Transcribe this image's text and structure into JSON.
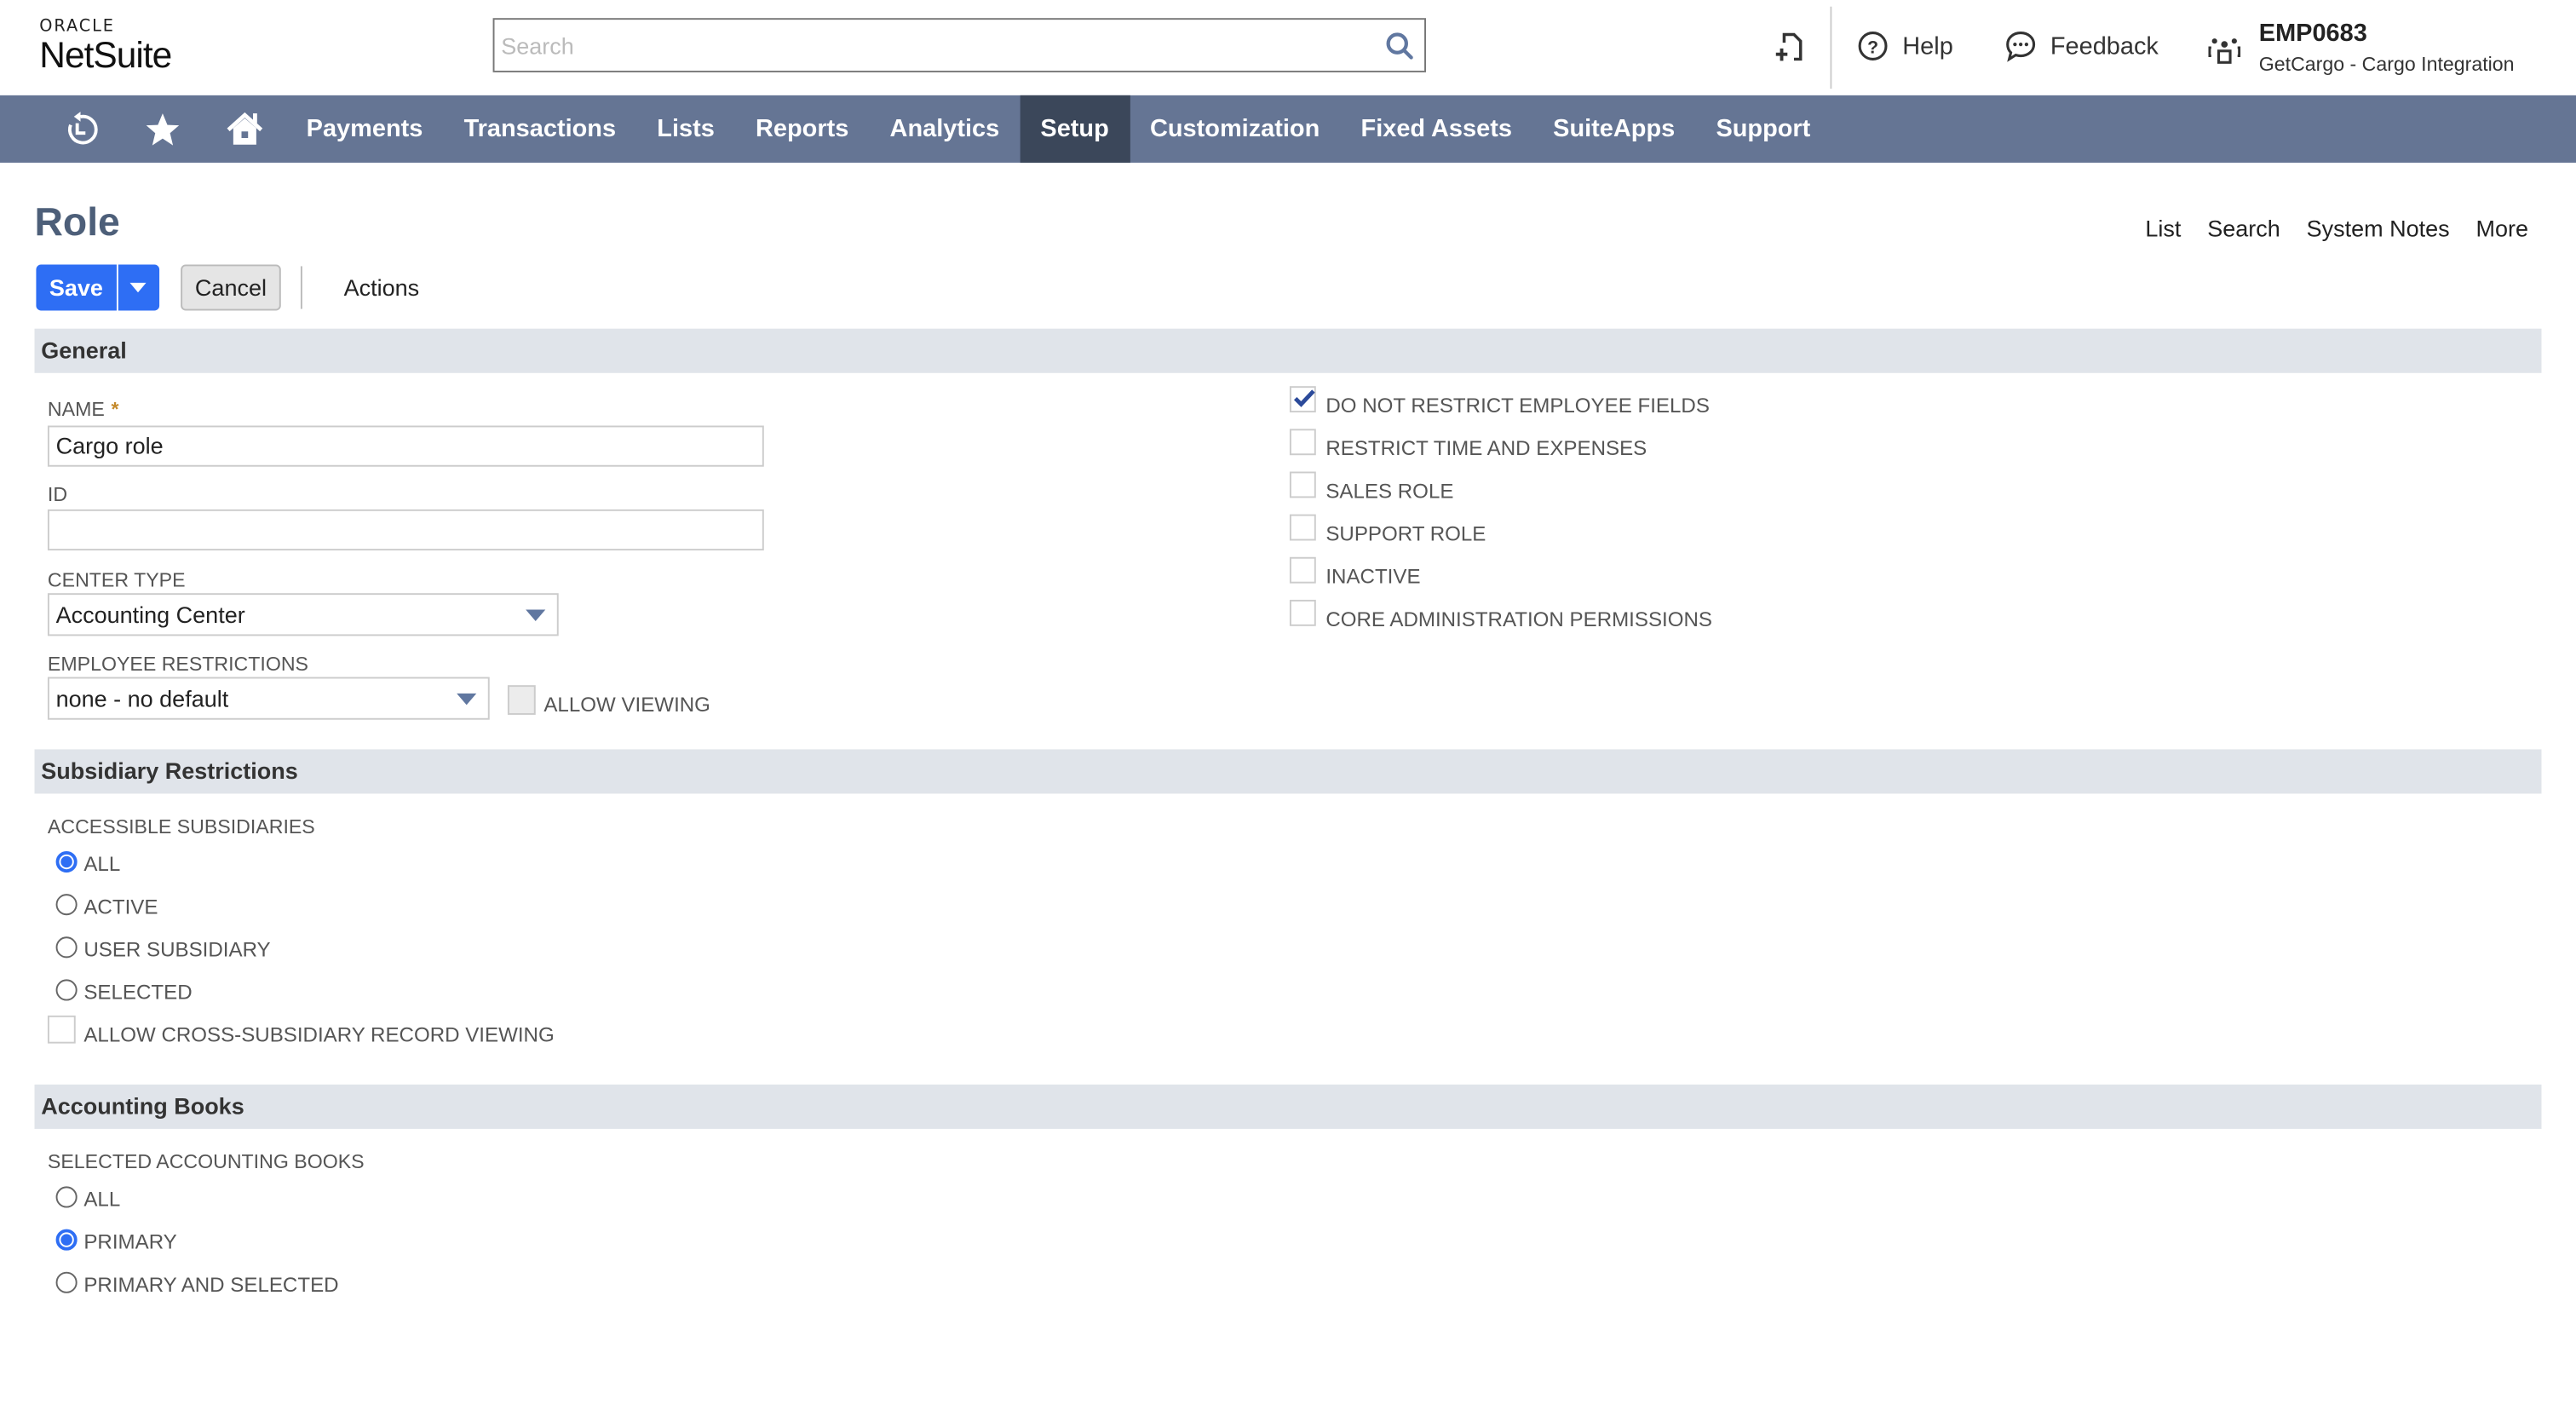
{
  "header": {
    "logo_top": "ORACLE",
    "logo_bottom": "NetSuite",
    "search_placeholder": "Search",
    "search_value": "",
    "help_label": "Help",
    "feedback_label": "Feedback",
    "account_id": "EMP0683",
    "account_company": "GetCargo - Cargo Integration"
  },
  "nav": {
    "icons": [
      "recent-records-icon",
      "favorites-star-icon",
      "home-icon"
    ],
    "items": [
      {
        "label": "Payments",
        "active": false
      },
      {
        "label": "Transactions",
        "active": false
      },
      {
        "label": "Lists",
        "active": false
      },
      {
        "label": "Reports",
        "active": false
      },
      {
        "label": "Analytics",
        "active": false
      },
      {
        "label": "Setup",
        "active": true
      },
      {
        "label": "Customization",
        "active": false
      },
      {
        "label": "Fixed Assets",
        "active": false
      },
      {
        "label": "SuiteApps",
        "active": false
      },
      {
        "label": "Support",
        "active": false
      }
    ]
  },
  "page": {
    "title": "Role",
    "right_links": [
      "List",
      "Search",
      "System Notes",
      "More"
    ],
    "toolbar": {
      "save_label": "Save",
      "cancel_label": "Cancel",
      "actions_label": "Actions"
    }
  },
  "general": {
    "section_title": "General",
    "name_label": "NAME",
    "name_required": "*",
    "name_value": "Cargo role",
    "id_label": "ID",
    "id_value": "",
    "center_type_label": "CENTER TYPE",
    "center_type_value": "Accounting Center",
    "employee_restrictions_label": "EMPLOYEE RESTRICTIONS",
    "employee_restrictions_value": "none - no default",
    "allow_viewing_label": "ALLOW VIEWING",
    "allow_viewing_checked": false,
    "checkboxes": [
      {
        "label": "DO NOT RESTRICT EMPLOYEE FIELDS",
        "checked": true
      },
      {
        "label": "RESTRICT TIME AND EXPENSES",
        "checked": false
      },
      {
        "label": "SALES ROLE",
        "checked": false
      },
      {
        "label": "SUPPORT ROLE",
        "checked": false
      },
      {
        "label": "INACTIVE",
        "checked": false
      },
      {
        "label": "CORE ADMINISTRATION PERMISSIONS",
        "checked": false
      }
    ]
  },
  "subsidiary": {
    "section_title": "Subsidiary Restrictions",
    "accessible_label": "ACCESSIBLE SUBSIDIARIES",
    "options": [
      {
        "label": "ALL",
        "selected": true
      },
      {
        "label": "ACTIVE",
        "selected": false
      },
      {
        "label": "USER SUBSIDIARY",
        "selected": false
      },
      {
        "label": "SELECTED",
        "selected": false
      }
    ],
    "cross_viewing_label": "ALLOW CROSS-SUBSIDIARY RECORD VIEWING",
    "cross_viewing_checked": false
  },
  "books": {
    "section_title": "Accounting Books",
    "selected_label": "SELECTED ACCOUNTING BOOKS",
    "options": [
      {
        "label": "ALL",
        "selected": false
      },
      {
        "label": "PRIMARY",
        "selected": true
      },
      {
        "label": "PRIMARY AND SELECTED",
        "selected": false
      }
    ]
  },
  "colors": {
    "nav_bg": "#657594",
    "nav_active": "#3b475a",
    "primary_button": "#2e6ef4",
    "section_bg": "#e0e4ea",
    "title_color": "#4d5f79",
    "required_star": "#c48a2c"
  }
}
